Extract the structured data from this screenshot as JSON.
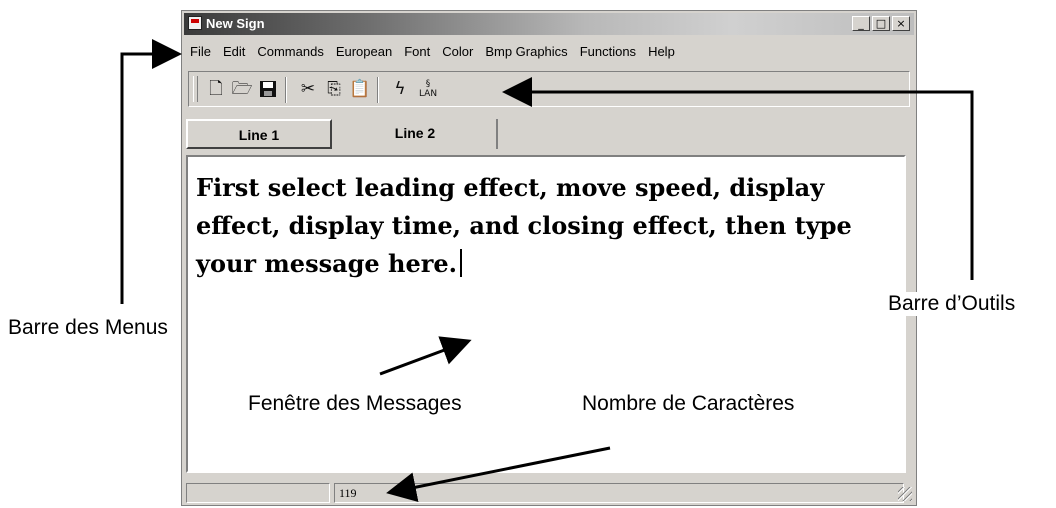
{
  "window": {
    "title": "New Sign",
    "controls": [
      "_",
      "□",
      "×"
    ]
  },
  "menu": {
    "items": [
      "File",
      "Edit",
      "Commands",
      "European",
      "Font",
      "Color",
      "Bmp Graphics",
      "Functions",
      "Help"
    ]
  },
  "toolbar": {
    "icons": [
      "new-file-icon",
      "open-folder-icon",
      "save-icon",
      "cut-icon",
      "copy-icon",
      "paste-icon",
      "lightning-icon",
      "lan-send-icon"
    ]
  },
  "tabs": [
    "Line 1",
    "Line 2"
  ],
  "editor": {
    "text": "First select leading effect, move speed, display effect, display time, and closing effect, then type your message here."
  },
  "status": {
    "character_count": "119"
  },
  "annotations": {
    "menu_bar": "Barre des Menus",
    "toolbar": "Barre d’Outils",
    "message_window": "Fenêtre des Messages",
    "character_count": "Nombre de Caractères"
  }
}
